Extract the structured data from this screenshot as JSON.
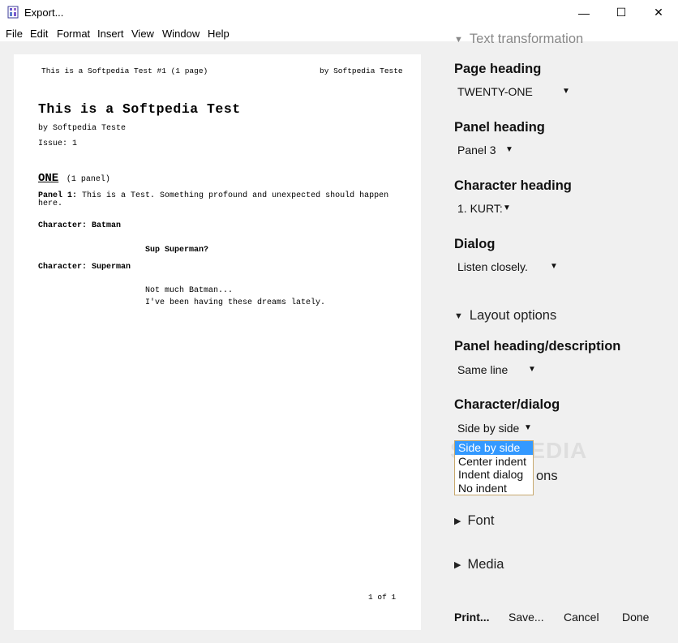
{
  "window": {
    "title": "Export...",
    "minimize_glyph": "—",
    "maximize_glyph": "☐",
    "close_glyph": "✕"
  },
  "menu": [
    "File",
    "Edit",
    "Format",
    "Insert",
    "View",
    "Window",
    "Help"
  ],
  "preview": {
    "header_left": "This is a Softpedia Test #1 (1 page)",
    "header_right": "by Softpedia Teste",
    "title": "This is a Softpedia Test",
    "byline": "by Softpedia Teste",
    "issue": "Issue: 1",
    "page_heading": "ONE",
    "page_panel_count": "(1 panel)",
    "panel_label": "Panel 1:",
    "panel_text_line1": "This is a Test. Something profound and unexpected should happen",
    "panel_text_line2": "here.",
    "char1_label": "Character: Batman",
    "char1_dialog": "Sup Superman?",
    "char2_label": "Character: Superman",
    "char2_dialog_line1": "Not much Batman...",
    "char2_dialog_line2": "I've been having these dreams lately.",
    "footer": "1 of 1"
  },
  "options": {
    "text_transformation": "Text transformation",
    "page_heading_label": "Page heading",
    "page_heading_value": "TWENTY-ONE",
    "panel_heading_label": "Panel heading",
    "panel_heading_value": "Panel 3",
    "character_heading_label": "Character heading",
    "character_heading_value": "1. KURT:",
    "dialog_label": "Dialog",
    "dialog_value": "Listen closely.",
    "layout_options": "Layout options",
    "panel_heading_desc_label": "Panel heading/description",
    "panel_heading_desc_value": "Same line",
    "character_dialog_label": "Character/dialog",
    "character_dialog_value": "Side by side",
    "hidden_section_tail": "ons",
    "font": "Font",
    "media": "Media",
    "dropdown_arrow": "▼",
    "expanded_triangle": "▼",
    "collapsed_triangle": "▶"
  },
  "dropdown_options": [
    "Side by side",
    "Center indent",
    "Indent dialog",
    "No indent"
  ],
  "buttons": {
    "print": "Print...",
    "save": "Save...",
    "cancel": "Cancel",
    "done": "Done"
  },
  "watermark": "SOFTPEDIA",
  "colors": {
    "selection": "#3399ff",
    "dropdown_border": "#c8a96e"
  }
}
